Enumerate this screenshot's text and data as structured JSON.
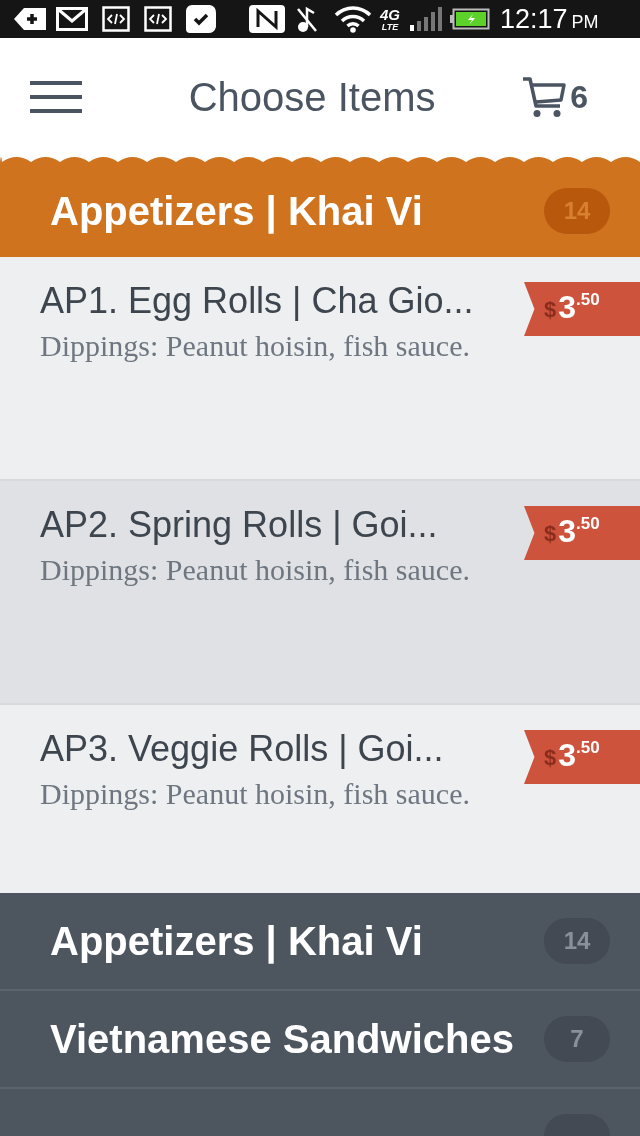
{
  "status_bar": {
    "time": "12:17",
    "meridiem": "PM",
    "network": "4G",
    "network_sub": "LTE"
  },
  "header": {
    "title": "Choose Items",
    "cart_count": "6"
  },
  "current_category": {
    "title": "Appetizers | Khai Vi",
    "count": "14"
  },
  "items": [
    {
      "title": "AP1. Egg Rolls | Cha Gio...",
      "description": "Dippings: Peanut hoisin, fish sauce.",
      "price": {
        "currency": "$",
        "whole": "3",
        "fraction": ".50"
      },
      "selected": false
    },
    {
      "title": "AP2. Spring Rolls | Goi...",
      "description": "Dippings: Peanut hoisin, fish sauce.",
      "price": {
        "currency": "$",
        "whole": "3",
        "fraction": ".50"
      },
      "selected": true
    },
    {
      "title": "AP3. Veggie Rolls | Goi...",
      "description": "Dippings: Peanut hoisin, fish sauce.",
      "price": {
        "currency": "$",
        "whole": "3",
        "fraction": ".50"
      },
      "selected": false
    }
  ],
  "categories": [
    {
      "title": "Appetizers | Khai Vi",
      "count": "14"
    },
    {
      "title": "Vietnamese Sandwiches",
      "count": "7"
    }
  ],
  "more_categories_below": true
}
